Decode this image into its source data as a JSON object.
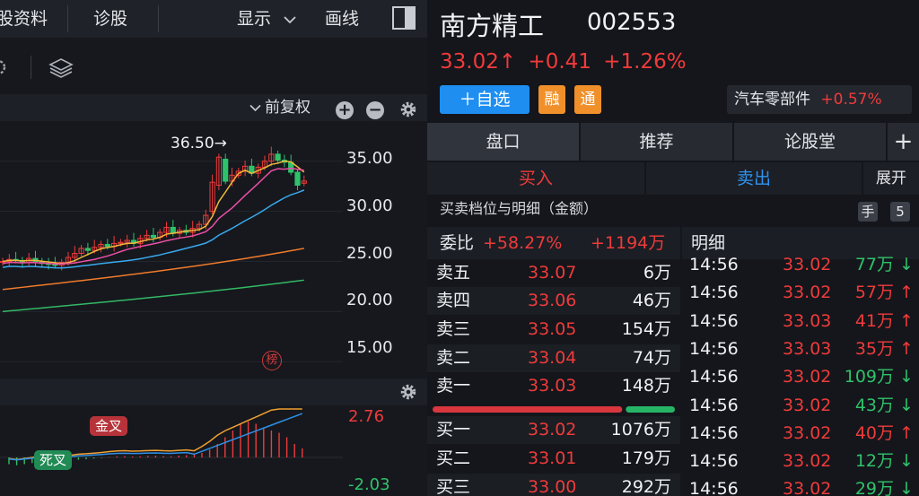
{
  "left_panel": {
    "topbar": {
      "profile_tab": "股资料",
      "diagnose_tab": "诊股",
      "display_menu": "显示",
      "draw_tab": "画线"
    },
    "kline": {
      "adjust_label": "前复权",
      "max_marker": "36.50→",
      "rank_badge": "榜"
    },
    "macd": {
      "golden_cross": "金叉",
      "death_cross": "死叉"
    }
  },
  "stock": {
    "name": "南方精工",
    "code": "002553",
    "price": "33.02↑",
    "change": "+0.41",
    "change_pct": "+1.26%",
    "add_watch": "＋自选",
    "margin_tag": "融",
    "connect_tag": "通",
    "sector_name": "汽车零部件",
    "sector_change": "+0.57%"
  },
  "tabs": [
    "盘口",
    "推荐",
    "论股堂"
  ],
  "tab_add": "+",
  "buy_tab": "买入",
  "sell_tab": "卖出",
  "expand": "展开",
  "detail_header": "买卖档位与明细（金额）",
  "unit_key": "手",
  "level_key": "5",
  "weibi": {
    "label": "委比",
    "pct": "+58.27%",
    "amount": "+1194万"
  },
  "ticks_header": "明细",
  "orderbook": [
    {
      "label": "卖五",
      "price": "33.07",
      "amount": "6万"
    },
    {
      "label": "卖四",
      "price": "33.06",
      "amount": "46万"
    },
    {
      "label": "卖三",
      "price": "33.05",
      "amount": "154万"
    },
    {
      "label": "卖二",
      "price": "33.04",
      "amount": "74万"
    },
    {
      "label": "卖一",
      "price": "33.03",
      "amount": "148万"
    },
    {
      "label": "买一",
      "price": "33.02",
      "amount": "1076万"
    },
    {
      "label": "买二",
      "price": "33.01",
      "amount": "179万"
    },
    {
      "label": "买三",
      "price": "33.00",
      "amount": "292万"
    }
  ],
  "buy_ratio": 0.79,
  "trades": [
    {
      "time": "14:56",
      "price": "33.02",
      "amount": "77万",
      "dir": "↓"
    },
    {
      "time": "14:56",
      "price": "33.02",
      "amount": "57万",
      "dir": "↑"
    },
    {
      "time": "14:56",
      "price": "33.03",
      "amount": "41万",
      "dir": "↑"
    },
    {
      "time": "14:56",
      "price": "33.03",
      "amount": "35万",
      "dir": "↑"
    },
    {
      "time": "14:56",
      "price": "33.02",
      "amount": "109万",
      "dir": "↓"
    },
    {
      "time": "14:56",
      "price": "33.02",
      "amount": "43万",
      "dir": "↓"
    },
    {
      "time": "14:56",
      "price": "33.02",
      "amount": "40万",
      "dir": "↑"
    },
    {
      "time": "14:56",
      "price": "33.02",
      "amount": "12万",
      "dir": "↓"
    },
    {
      "time": "14:56",
      "price": "33.02",
      "amount": "29万",
      "dir": "↓"
    }
  ],
  "colors": {
    "up": "#ef3b3b",
    "down": "#2fc26b",
    "accent": "#1f8ef1",
    "tag": "#f0902b"
  },
  "chart_data": [
    {
      "type": "candlestick",
      "y_ticks": [
        "35.00",
        "30.00",
        "25.00",
        "20.00",
        "15.00"
      ],
      "ylim": [
        13.5,
        39
      ],
      "ma_lines": [
        "MA5",
        "MA10",
        "MA20",
        "MA30",
        "MA60"
      ],
      "max_value": 36.5,
      "closes": [
        25.0,
        25.2,
        25.1,
        24.9,
        25.3,
        25.0,
        24.8,
        24.7,
        24.6,
        24.9,
        25.4,
        25.8,
        26.3,
        26.1,
        26.4,
        26.7,
        26.5,
        26.8,
        26.9,
        27.1,
        26.8,
        27.3,
        27.6,
        27.4,
        27.9,
        28.4,
        27.8,
        28.1,
        27.9,
        28.3,
        28.7,
        29.6,
        32.9,
        35.4,
        33.0,
        33.6,
        34.0,
        34.5,
        33.8,
        34.4,
        35.0,
        35.7,
        35.1,
        34.9,
        33.9,
        32.6,
        33.02
      ],
      "opens": [
        24.9,
        25.0,
        25.2,
        25.1,
        24.9,
        25.3,
        25.0,
        24.8,
        24.7,
        24.6,
        24.9,
        25.4,
        25.8,
        26.3,
        26.1,
        26.4,
        26.7,
        26.5,
        26.8,
        26.9,
        27.1,
        26.8,
        27.3,
        27.6,
        27.4,
        27.9,
        28.4,
        27.8,
        28.1,
        27.9,
        28.3,
        28.7,
        30.0,
        32.6,
        35.2,
        33.0,
        33.6,
        34.0,
        34.5,
        33.8,
        34.4,
        35.0,
        35.7,
        35.1,
        34.9,
        33.9,
        32.8
      ],
      "last_close": 33.02
    },
    {
      "type": "line",
      "name": "MACD",
      "y_ticks": [
        "2.76",
        "-2.03"
      ],
      "bars": [
        -0.3,
        -0.35,
        -0.3,
        -0.25,
        -0.2,
        -0.22,
        -0.25,
        -0.2,
        -0.15,
        -0.1,
        -0.08,
        -0.05,
        -0.02,
        0.02,
        0.05,
        0.06,
        0.04,
        0.05,
        0.07,
        0.08,
        0.06,
        0.05,
        0.08,
        0.1,
        0.12,
        0.2,
        0.35,
        0.6,
        0.9,
        1.2,
        1.5,
        1.6,
        1.5,
        1.3,
        1.2,
        1.1,
        0.9,
        0.6,
        0.4
      ]
    }
  ]
}
